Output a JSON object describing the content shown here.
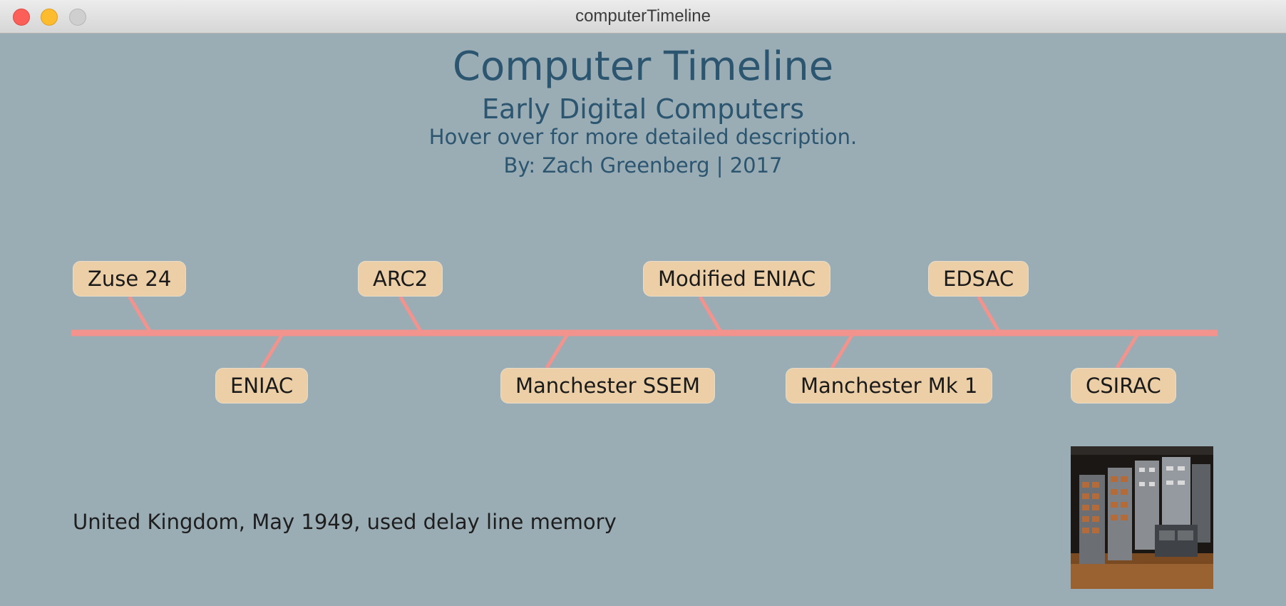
{
  "window": {
    "title": "computerTimeline"
  },
  "header": {
    "title": "Computer Timeline",
    "subtitle": "Early Digital Computers",
    "instruction": "Hover over for more detailed description.",
    "byline": "By: Zach Greenberg | 2017"
  },
  "timeline": {
    "line_color": "#f2938d",
    "box_color": "#eccfa7",
    "events": [
      {
        "label": "Zuse 24",
        "position": "above"
      },
      {
        "label": "ENIAC",
        "position": "below"
      },
      {
        "label": "ARC2",
        "position": "above"
      },
      {
        "label": "Manchester SSEM",
        "position": "below"
      },
      {
        "label": "Modified ENIAC",
        "position": "above"
      },
      {
        "label": "Manchester Mk 1",
        "position": "below"
      },
      {
        "label": "EDSAC",
        "position": "above"
      },
      {
        "label": "CSIRAC",
        "position": "below"
      }
    ]
  },
  "detail": {
    "description": "United Kingdom, May 1949, used delay line memory",
    "image_alt": "EDSAC computer photo"
  },
  "colors": {
    "background": "#9aadb5",
    "heading_text": "#2c5570"
  }
}
